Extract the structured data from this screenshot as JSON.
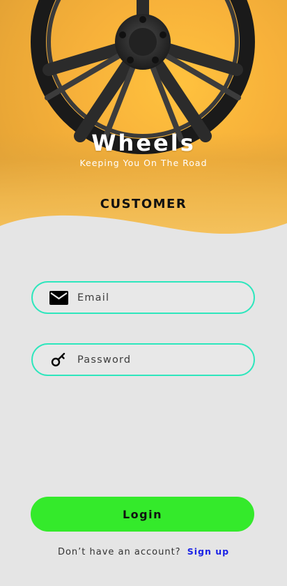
{
  "brand": {
    "title": "Wheels",
    "tagline": "Keeping You On The Road"
  },
  "role_label": "CUSTOMER",
  "form": {
    "email": {
      "value": "",
      "placeholder": "Email",
      "icon": "mail-icon"
    },
    "password": {
      "value": "",
      "placeholder": "Password",
      "icon": "key-icon"
    }
  },
  "login_button": {
    "label": "Login"
  },
  "signup": {
    "prompt": "Don’t have an account?",
    "link_label": "Sign up"
  },
  "colors": {
    "hero_background": "#f7b13a",
    "page_background": "#e5e5e5",
    "field_border": "#2ee6bd",
    "login_button": "#34ea2b",
    "signup_link": "#1a22e6"
  }
}
